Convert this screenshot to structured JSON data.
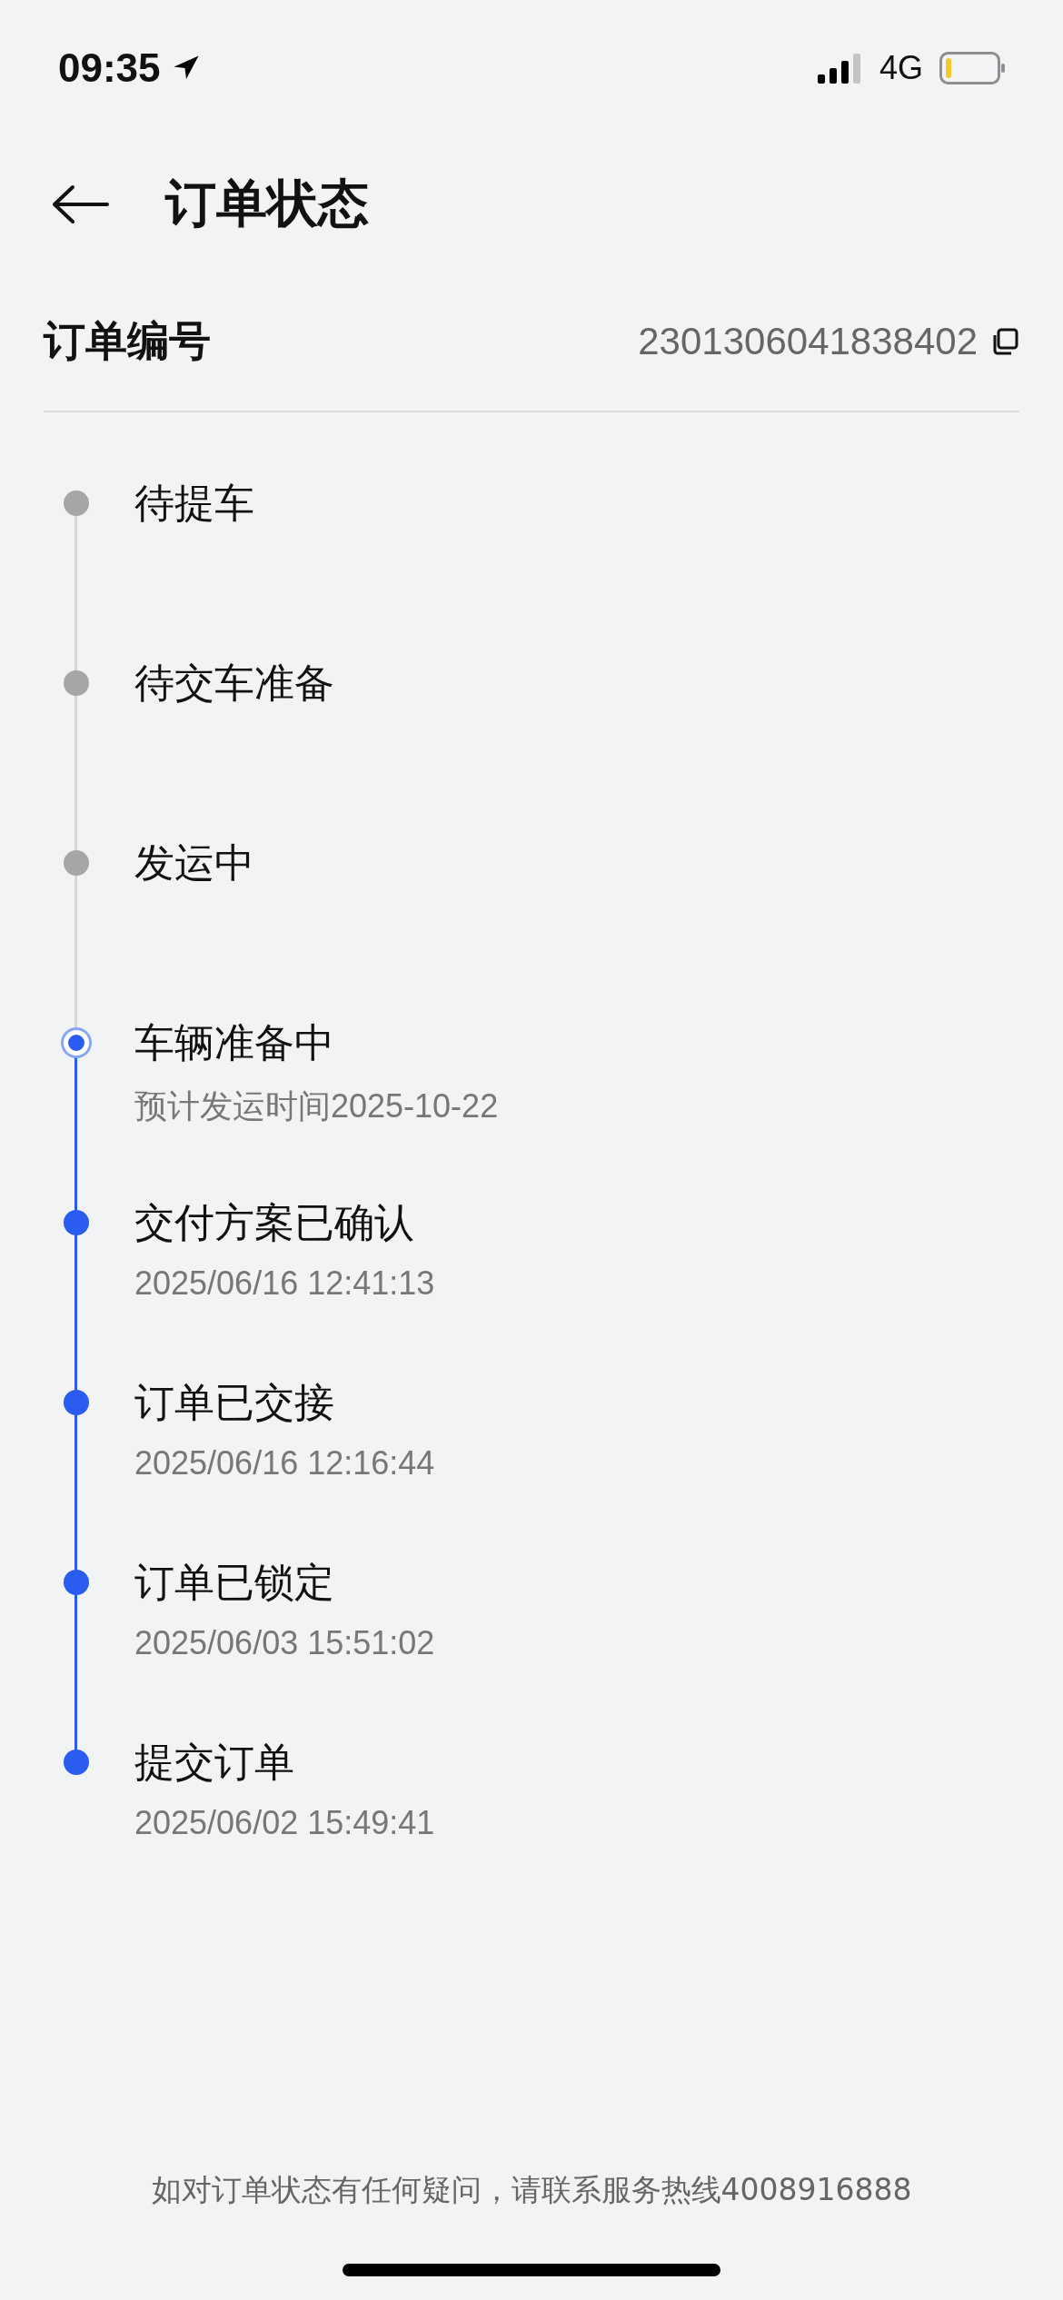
{
  "status_bar": {
    "time": "09:35",
    "network": "4G"
  },
  "header": {
    "title": "订单状态"
  },
  "order": {
    "label": "订单编号",
    "number": "2301306041838402"
  },
  "timeline": [
    {
      "title": "待提车",
      "kind": "pending"
    },
    {
      "title": "待交车准备",
      "kind": "pending"
    },
    {
      "title": "发运中",
      "kind": "pending"
    },
    {
      "title": "车辆准备中",
      "subtitle": "预计发运时间2025-10-22",
      "kind": "current"
    },
    {
      "title": "交付方案已确认",
      "subtitle": "2025/06/16 12:41:13",
      "kind": "done"
    },
    {
      "title": "订单已交接",
      "subtitle": "2025/06/16 12:16:44",
      "kind": "done"
    },
    {
      "title": "订单已锁定",
      "subtitle": "2025/06/03 15:51:02",
      "kind": "done"
    },
    {
      "title": "提交订单",
      "subtitle": "2025/06/02 15:49:41",
      "kind": "done"
    }
  ],
  "footer": {
    "note": "如对订单状态有任何疑问，请联系服务热线4008916888"
  }
}
